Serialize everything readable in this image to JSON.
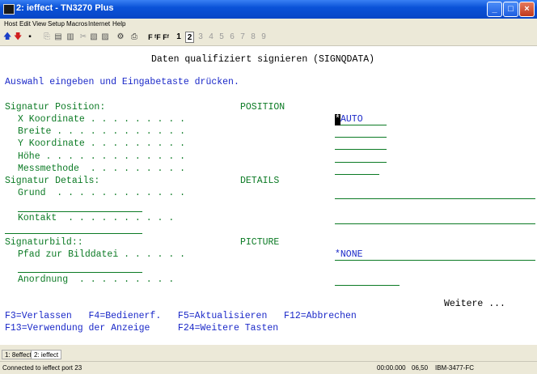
{
  "window": {
    "title": "2: ieffect - TN3270 Plus"
  },
  "menu": [
    "Host",
    "Edit",
    "View",
    "Setup",
    "Macros",
    "Internet",
    "Help"
  ],
  "toolbar": {
    "fkeys_text": "F  ᶠF  Fᶠ",
    "sessions": [
      "1",
      "2",
      "3",
      "4",
      "5",
      "6",
      "7",
      "8",
      "9"
    ],
    "active_session": "2"
  },
  "screen": {
    "title": "Daten qualifiziert signieren (SIGNQDATA)",
    "instruction": "Auswahl eingeben und Eingabetaste drücken.",
    "position_section": "Signatur Position:",
    "position_tag": "POSITION",
    "x_label": "X Koordinate . . . . . . . . .",
    "x_value_cursor": "*",
    "x_value": "AUTO",
    "breite_label": "Breite . . . . . . . . . . . .",
    "y_label": "Y Koordinate . . . . . . . . .",
    "hoehe_label": "Höhe . . . . . . . . . . . . .",
    "mess_label": "Messmethode  . . . . . . . . .",
    "details_section": "Signatur Details:",
    "details_tag": "DETAILS",
    "grund_label": "Grund  . . . . . . . . . . . .",
    "kontakt_label": "Kontakt  . . . . . . . . . .",
    "bild_section": "Signaturbild::",
    "bild_tag": "PICTURE",
    "pfad_label": "Pfad zur Bilddatei . . . . . .",
    "pfad_value": "*NONE",
    "anordnung_label": "Anordnung  . . . . . . . . .",
    "more": "Weitere ...",
    "fkeys_row1": "F3=Verlassen   F4=Bedienerf.   F5=Aktualisieren   F12=Abbrechen",
    "fkeys_row2": "F13=Verwendung der Anzeige     F24=Weitere Tasten"
  },
  "tabs": [
    "1: 8effect",
    "2: ieffect"
  ],
  "status": {
    "left": "Connected to ieffect port 23",
    "time": "00:00.000",
    "cursor_pos": "06,50",
    "model": "IBM-3477-FC"
  },
  "colors": {
    "field_green": "#0b7a24",
    "text_blue": "#1a28c8",
    "titlebar_blue": "#0a52d8"
  }
}
